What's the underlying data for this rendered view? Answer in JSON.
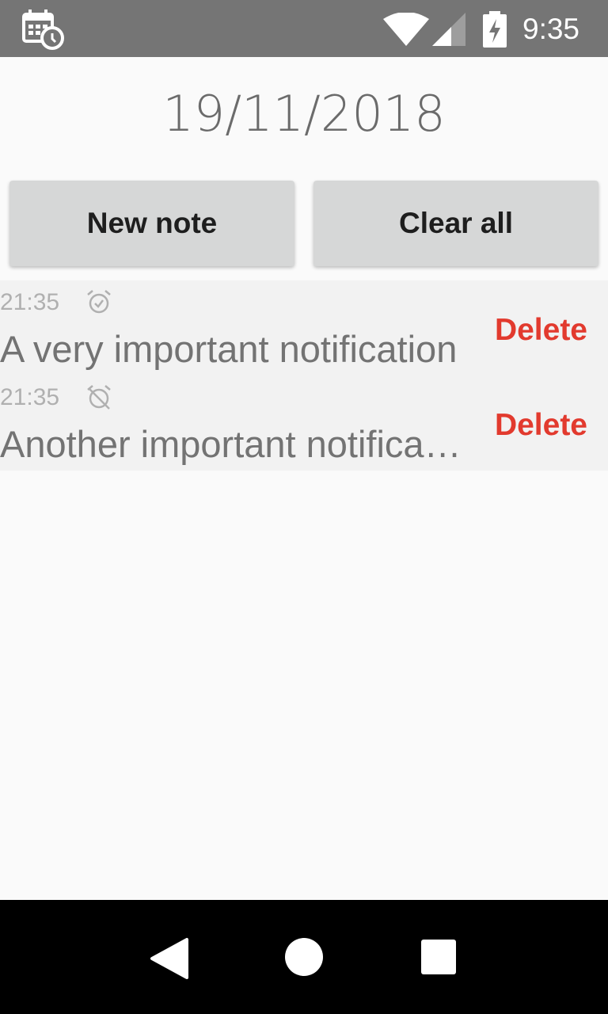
{
  "status_bar": {
    "time": "9:35",
    "icons": [
      "calendar-clock-icon",
      "wifi-icon",
      "signal-icon",
      "battery-charging-icon"
    ]
  },
  "header": {
    "date": "19/11/2018"
  },
  "actions": {
    "new_note_label": "New note",
    "clear_all_label": "Clear all"
  },
  "notes": [
    {
      "time": "21:35",
      "alarm_icon": "alarm-on-icon",
      "text": "A very important notification",
      "delete_label": "Delete"
    },
    {
      "time": "21:35",
      "alarm_icon": "alarm-off-icon",
      "text": "Another important notification",
      "delete_label": "Delete"
    }
  ],
  "colors": {
    "status_bar": "#757575",
    "delete": "#e23a2e",
    "button_bg": "#d6d7d7",
    "list_bg": "#f2f2f2"
  },
  "nav_bar": {
    "icons": [
      "back-icon",
      "home-icon",
      "recents-icon"
    ]
  }
}
